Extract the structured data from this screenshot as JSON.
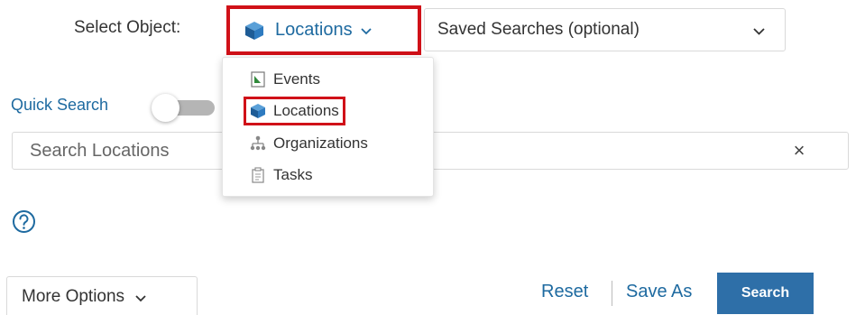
{
  "select_object": {
    "label": "Select Object:",
    "value": "Locations",
    "icon": "cube-icon"
  },
  "saved_searches": {
    "value": "Saved Searches (optional)"
  },
  "dropdown": {
    "items": [
      {
        "label": "Events",
        "icon": "document-icon"
      },
      {
        "label": "Locations",
        "icon": "cube-icon",
        "selected": true
      },
      {
        "label": "Organizations",
        "icon": "org-chart-icon"
      },
      {
        "label": "Tasks",
        "icon": "clipboard-icon"
      }
    ]
  },
  "quick_search": {
    "label": "Quick Search",
    "enabled": false
  },
  "search": {
    "placeholder": "Search Locations",
    "clear": "×"
  },
  "more_options": {
    "label": "More Options"
  },
  "actions": {
    "reset": "Reset",
    "save_as": "Save As",
    "search": "Search"
  },
  "colors": {
    "accent": "#1e6aa0",
    "highlight": "#d01118",
    "primary_button": "#2e6fa8"
  }
}
